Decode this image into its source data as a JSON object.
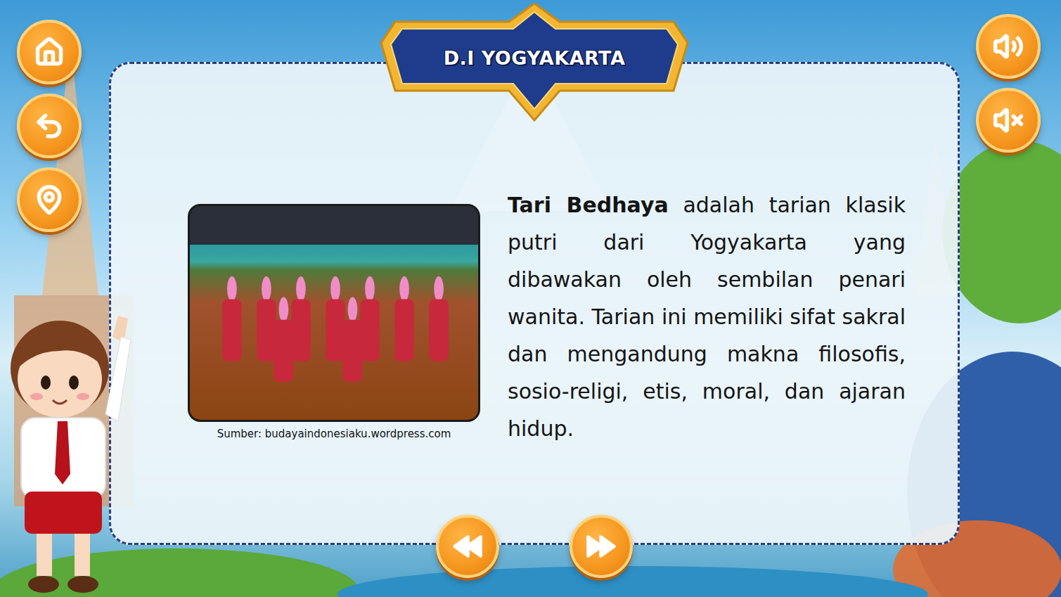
{
  "banner": {
    "title": "D.I YOGYAKARTA"
  },
  "content": {
    "term": "Tari Bedhaya",
    "description": " adalah tarian klasik putri dari Yogyakarta yang dibawakan oleh sembilan penari wanita. Tarian ini memiliki sifat sakral dan mengandung makna filosofis, sosio-religi, etis, moral, dan ajaran hidup.",
    "photo_caption": "Sumber: budayaindonesiaku.wordpress.com"
  }
}
